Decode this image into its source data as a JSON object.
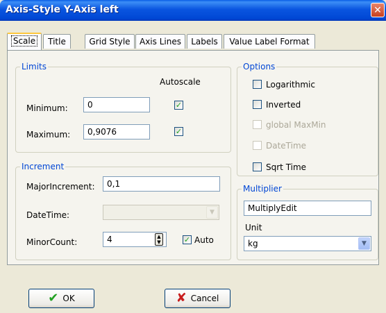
{
  "window": {
    "title": "Axis-Style Y-Axis left",
    "close_glyph": "✕"
  },
  "tabs": [
    {
      "label": "Scale"
    },
    {
      "label": "Title"
    },
    {
      "label": "Grid Style"
    },
    {
      "label": "Axis Lines"
    },
    {
      "label": "Labels"
    },
    {
      "label": "Value Label Format"
    }
  ],
  "limits": {
    "title": "Limits",
    "autoscale_header": "Autoscale",
    "minimum_label": "Minimum:",
    "minimum_value": "0",
    "minimum_autoscale": true,
    "maximum_label": "Maximum:",
    "maximum_value": "0,9076",
    "maximum_autoscale": true
  },
  "increment": {
    "title": "Increment",
    "major_label": "MajorIncrement:",
    "major_value": "0,1",
    "datetime_label": "DateTime:",
    "datetime_value": "",
    "minor_label": "MinorCount:",
    "minor_value": "4",
    "auto_label": "Auto",
    "auto_checked": true
  },
  "options": {
    "title": "Options",
    "items": [
      {
        "label": "Logarithmic",
        "checked": false,
        "enabled": true
      },
      {
        "label": "Inverted",
        "checked": false,
        "enabled": true
      },
      {
        "label": "global MaxMin",
        "checked": false,
        "enabled": false
      },
      {
        "label": "DateTime",
        "checked": false,
        "enabled": false
      },
      {
        "label": "Sqrt Time",
        "checked": false,
        "enabled": true
      }
    ]
  },
  "multiplier": {
    "title": "Multiplier",
    "edit_value": "MultiplyEdit",
    "unit_label": "Unit",
    "unit_value": "kg"
  },
  "buttons": {
    "ok_label": "OK",
    "cancel_label": "Cancel"
  },
  "colors": {
    "title_bar": "#0a55e0",
    "group_title": "#0046d5",
    "ok_check": "#21a121",
    "cancel_x": "#c81e1e"
  }
}
